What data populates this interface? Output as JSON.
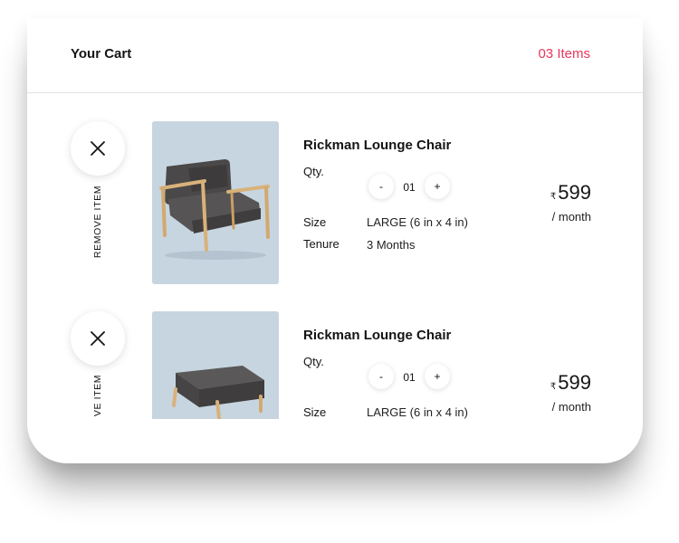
{
  "cart": {
    "title": "Your Cart",
    "count": "03 Items",
    "accent_color": "#e8365d"
  },
  "labels": {
    "remove": "REMOVE ITEM",
    "remove_partial": "VE ITEM",
    "qty": "Qty.",
    "size": "Size",
    "tenure": "Tenure",
    "decrement": "-",
    "increment": "+",
    "currency": "₹",
    "per_month": "/ month"
  },
  "items": [
    {
      "name": "Rickman Lounge Chair",
      "image": "lounge-chair-image",
      "qty": "01",
      "size": "LARGE (6 in x 4 in)",
      "tenure": "3 Months",
      "price": "599"
    },
    {
      "name": "Rickman Lounge Chair",
      "image": "ottoman-image",
      "qty": "01",
      "size": "LARGE (6 in x 4 in)",
      "price": "599"
    }
  ]
}
